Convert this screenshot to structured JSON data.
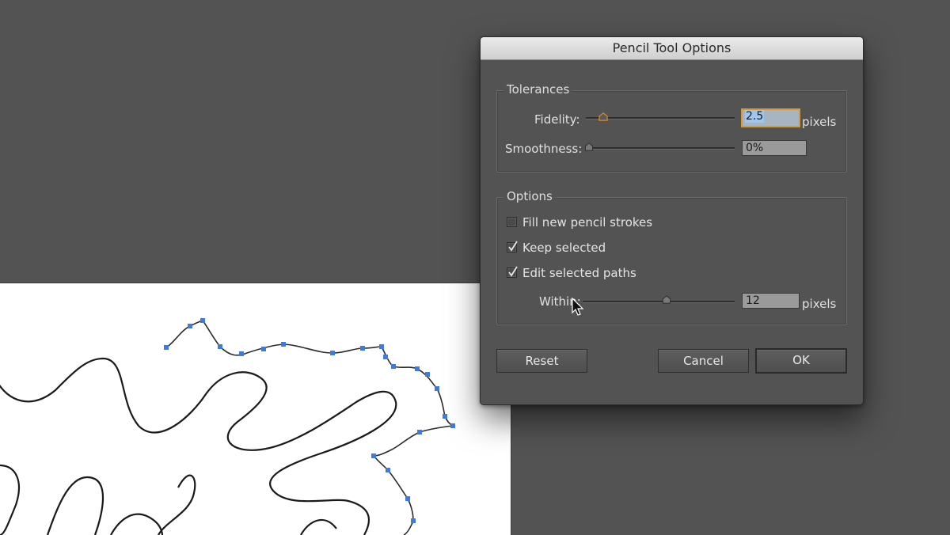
{
  "dialog": {
    "title": "Pencil Tool Options",
    "tolerances": {
      "title": "Tolerances",
      "fidelity": {
        "label": "Fidelity:",
        "value": "2.5",
        "unit": "pixels"
      },
      "smoothness": {
        "label": "Smoothness:",
        "value": "0%"
      }
    },
    "options": {
      "title": "Options",
      "checkboxes": [
        {
          "label": "Fill new pencil strokes",
          "checked": false
        },
        {
          "label": "Keep selected",
          "checked": true
        },
        {
          "label": "Edit selected paths",
          "checked": true
        }
      ],
      "within": {
        "label": "Within:",
        "value": "12",
        "unit": "pixels"
      }
    },
    "buttons": {
      "reset": "Reset",
      "cancel": "Cancel",
      "ok": "OK"
    }
  },
  "colors": {
    "background": "#535353",
    "accent_focus": "#d49a3c",
    "path_anchor": "#3d7bde"
  },
  "icons": [
    "checkmark-icon",
    "slider-thumb-icon",
    "arrow-cursor-icon"
  ]
}
